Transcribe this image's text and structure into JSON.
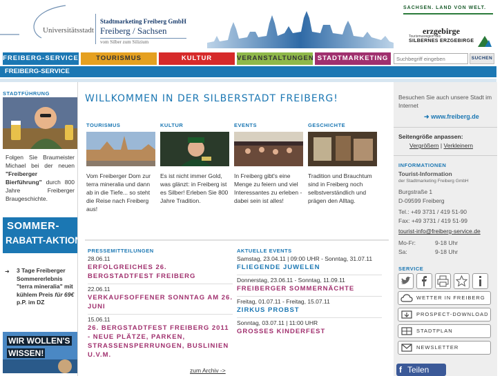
{
  "header": {
    "uni": "Universitätsstadt",
    "gmbh": "Stadtmarketing Freiberg GmbH",
    "city": "Freiberg / Sachsen",
    "tag": "vom Silber zum Silizium",
    "sachsen": "SACHSEN. LAND VON WELT.",
    "erzgebirge": "erzgebirge",
    "erz_small": "Tourismusregion des",
    "erz_silver": "SILBERNES ERZGEBIRGE"
  },
  "nav": {
    "tabs": [
      {
        "label": "FREIBERG-SERVICE",
        "bg": "#1b77b3",
        "fg": "#ffffff"
      },
      {
        "label": "TOURISMUS",
        "bg": "#e5a020",
        "fg": "#333333"
      },
      {
        "label": "KULTUR",
        "bg": "#d62a2a",
        "fg": "#ffffff"
      },
      {
        "label": "VERANSTALTUNGEN",
        "bg": "#8fb84a",
        "fg": "#333333"
      },
      {
        "label": "STADTMARKETING",
        "bg": "#a0306e",
        "fg": "#ffffff"
      }
    ],
    "search_placeholder": "Suchbegriff eingeben",
    "search_button": "SUCHEN",
    "subbar": "FREIBERG-SERVICE"
  },
  "left": {
    "title": "STADTFÜHRUNG",
    "text_intro": "Folgen Sie Braumeister Michael bei der neuen",
    "text_bold": "\"Freiberger Bierführung\"",
    "text_rest": "durch 800 Jahre Freiberger Braugeschichte.",
    "banner1_line1": "SOMMER-",
    "banner1_line2": "RABATT-AKTION",
    "promo_bullet": "➜",
    "promo_text1": "3 Tage Freiberger Sommererlebnis \"terra mineralia\" mit kühlem Preis",
    "promo_em": "für 69€",
    "promo_text2": "p.P. im DZ",
    "banner2_line1": "WIR WOLLEN'S",
    "banner2_line2": "WISSEN!"
  },
  "main": {
    "title": "WILLKOMMEN IN DER SILBERSTADT FREIBERG!",
    "columns": [
      {
        "heading": "TOURISMUS",
        "text": "Vom Freiberger Dom zur terra mineralia und dann ab in die Tiefe... so steht die Reise nach Freiberg aus!"
      },
      {
        "heading": "KULTUR",
        "text": "Es ist nicht immer Gold, was glänzt: in Freiberg ist es Silber! Erleben Sie 800 Jahre Tradition."
      },
      {
        "heading": "EVENTS",
        "text": "In Freiberg gibt's eine Menge zu feiern und viel Interessantes zu erleben - dabei sein ist alles!"
      },
      {
        "heading": "GESCHICHTE",
        "text": "Tradition und Brauchtum sind in Freiberg noch selbstverständlich und prägen den Alltag."
      }
    ],
    "press": {
      "heading": "PRESSEMITTEILUNGEN",
      "items": [
        {
          "date": "28.06.11",
          "title": "ERFOLGREICHES 26. BERGSTADTFEST FREIBERG"
        },
        {
          "date": "22.06.11",
          "title": "VERKAUFSOFFENER SONNTAG AM 26. JUNI"
        },
        {
          "date": "15.06.11",
          "title": "26. BERGSTADTFEST FREIBERG 2011 - NEUE PLÄTZE, PARKEN, STRASSENSPERRUNGEN, BUSLINIEN U.V.M."
        }
      ],
      "archive": "zum Archiv ->"
    },
    "events": {
      "heading": "AKTUELLE EVENTS",
      "items": [
        {
          "date": "Samstag, 23.04.11 | 09:00 UHR - Sonntag, 31.07.11",
          "title": "FLIEGENDE JUWELEN"
        },
        {
          "date": "Donnerstag, 23.06.11 - Sonntag, 11.09.11",
          "title": "FREIBERGER SOMMERNÄCHTE"
        },
        {
          "date": "Freitag, 01.07.11 - Freitag, 15.07.11",
          "title": "ZIRKUS PROBST"
        },
        {
          "date": "Sonntag, 03.07.11 | 11:00 UHR",
          "title": "GROSSES KINDERFEST"
        }
      ]
    }
  },
  "right": {
    "visit_text": "Besuchen Sie auch unsere Stadt im Internet",
    "visit_link": "www.freiberg.de",
    "size_title": "Seitengröße anpassen:",
    "size_bigger": "Vergrößern",
    "size_sep": "|",
    "size_smaller": "Verkleinern",
    "info_heading": "INFORMATIONEN",
    "info_name": "Tourist-Information",
    "info_sub": "der Stadtmarketing Freiberg GmbH",
    "info_street": "Burgstraße 1",
    "info_zip": "D-09599 Freiberg",
    "info_tel": "Tel.: +49 3731 / 419 51-90",
    "info_fax": "Fax: +49 3731 / 419 51-99",
    "info_mail": "tourist-info@freiberg-service.de",
    "hours": [
      {
        "day": "Mo-Fr:",
        "time": "9-18 Uhr"
      },
      {
        "day": "Sa:",
        "time": "9-18 Uhr"
      }
    ],
    "service_heading": "SERVICE",
    "icons": [
      "twitter-icon",
      "facebook-icon",
      "print-icon",
      "star-icon",
      "info-icon"
    ],
    "buttons": [
      {
        "label": "WETTER IN FREIBERG",
        "icon": "cloud-icon"
      },
      {
        "label": "PROSPECT-DOWNLOAD",
        "icon": "download-icon"
      },
      {
        "label": "STADTPLAN",
        "icon": "map-icon"
      },
      {
        "label": "NEWSLETTER",
        "icon": "mail-icon"
      }
    ],
    "facebook": "Teilen"
  },
  "colors": {
    "accent": "#1b77b3",
    "magenta": "#a0306e"
  }
}
